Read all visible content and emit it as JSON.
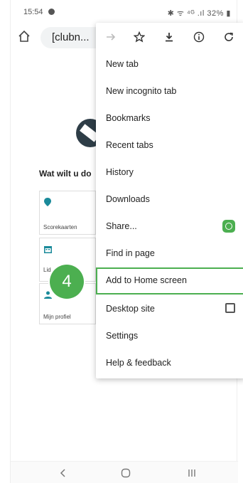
{
  "status_bar": {
    "time": "15:54",
    "right_text": "✱ ᯤ ⁴ᴳ .ıl 32% ▮"
  },
  "toolbar": {
    "url": "[clubn..."
  },
  "page": {
    "heading": "Wat wilt u do",
    "cards": [
      {
        "label": "Scorekaarten",
        "icon": "pin-icon"
      },
      {
        "label": "Lid",
        "icon": "calendar-icon"
      },
      {
        "label": "Mijn profiel",
        "icon": "person-icon"
      }
    ]
  },
  "menu": {
    "icons": [
      "forward-icon",
      "star-icon",
      "download-icon",
      "info-icon",
      "refresh-icon"
    ],
    "items": [
      {
        "label": "New tab"
      },
      {
        "label": "New incognito tab"
      },
      {
        "label": "Bookmarks"
      },
      {
        "label": "Recent tabs"
      },
      {
        "label": "History"
      },
      {
        "label": "Downloads"
      },
      {
        "label": "Share..."
      },
      {
        "label": "Find in page"
      },
      {
        "label": "Add to Home screen"
      },
      {
        "label": "Desktop site"
      },
      {
        "label": "Settings"
      },
      {
        "label": "Help & feedback"
      }
    ]
  },
  "step_badge": {
    "number": "4"
  },
  "colors": {
    "accent_green": "#4caf50"
  }
}
